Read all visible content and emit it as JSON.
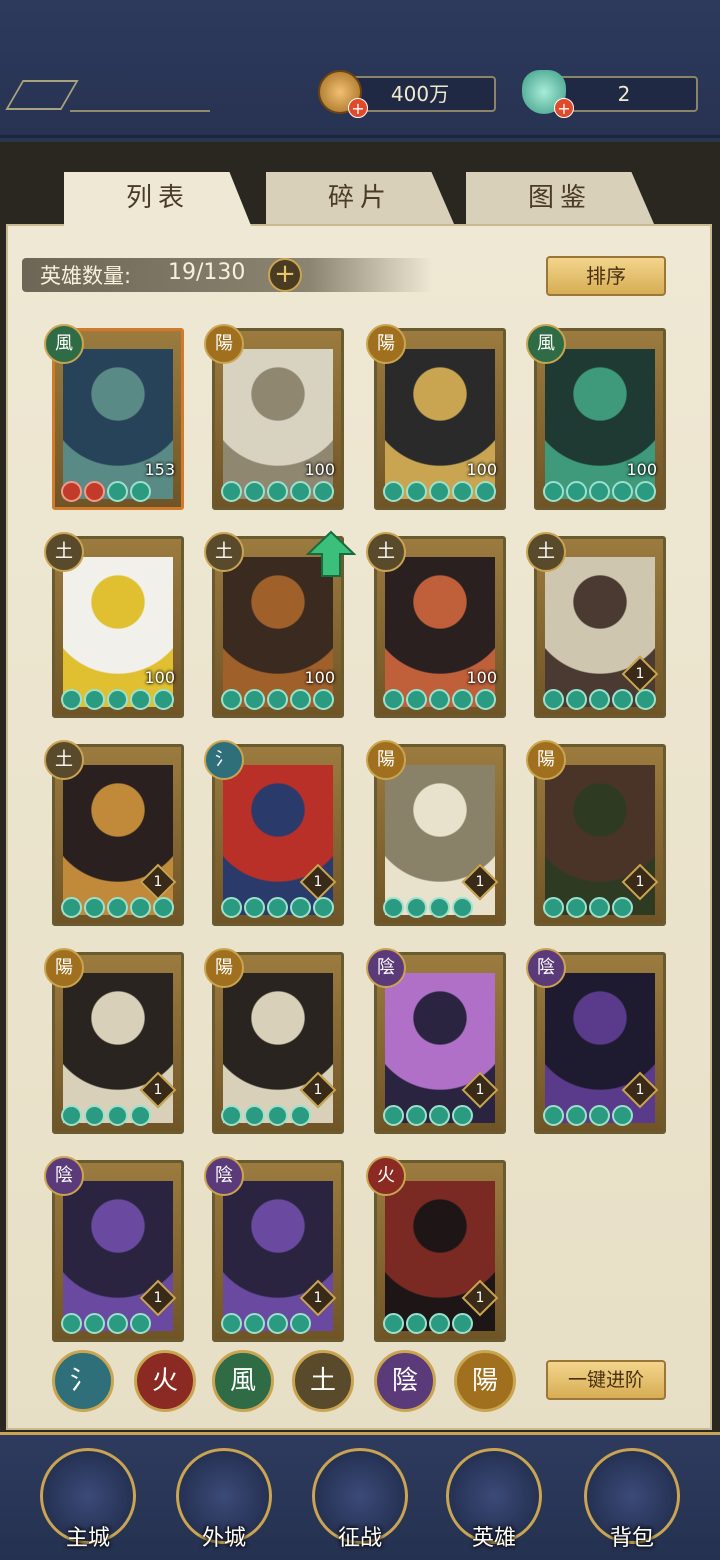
{
  "resources": {
    "coins": "400万",
    "jade": "2"
  },
  "tabs": [
    "列表",
    "碎片",
    "图鉴"
  ],
  "hero_count": {
    "label": "英雄数量:",
    "value": "19/130"
  },
  "sort_button": "排序",
  "advance_button": "一键进阶",
  "elements": {
    "water": "氵",
    "fire": "火",
    "wind": "風",
    "earth": "土",
    "yin": "陰",
    "yang": "陽"
  },
  "element_colors": {
    "water": "#2f6f7a",
    "fire": "#8a2a22",
    "wind": "#2f6b45",
    "earth": "#5a4a2c",
    "yin": "#5b3a7a",
    "yang": "#a0701e"
  },
  "heroes": [
    {
      "element": "wind",
      "level": "153",
      "stars": 2,
      "red_stars": 2,
      "frame": "orange",
      "badge": "text",
      "palette": [
        "#27435a",
        "#5a8a86"
      ]
    },
    {
      "element": "yang",
      "level": "100",
      "stars": 5,
      "red_stars": 0,
      "frame": "gold",
      "badge": "text",
      "palette": [
        "#d8d2c0",
        "#8f8770"
      ]
    },
    {
      "element": "yang",
      "level": "100",
      "stars": 5,
      "red_stars": 0,
      "frame": "gold",
      "badge": "text",
      "palette": [
        "#2a2a2a",
        "#c9a552"
      ]
    },
    {
      "element": "wind",
      "level": "100",
      "stars": 5,
      "red_stars": 0,
      "frame": "gold",
      "badge": "text",
      "palette": [
        "#1f3a32",
        "#3e9a7a"
      ]
    },
    {
      "element": "earth",
      "level": "100",
      "stars": 5,
      "red_stars": 0,
      "frame": "gold",
      "badge": "text",
      "palette": [
        "#f2f0ea",
        "#e0c030"
      ]
    },
    {
      "element": "earth",
      "level": "100",
      "stars": 5,
      "red_stars": 0,
      "frame": "gold",
      "badge": "text",
      "palette": [
        "#3a2a20",
        "#a0602a"
      ]
    },
    {
      "element": "earth",
      "level": "100",
      "stars": 5,
      "red_stars": 0,
      "frame": "gold",
      "badge": "text",
      "palette": [
        "#2a2020",
        "#c0603a"
      ]
    },
    {
      "element": "earth",
      "level": "1",
      "stars": 5,
      "red_stars": 0,
      "frame": "gold",
      "badge": "diamond",
      "palette": [
        "#cfc6b0",
        "#4a3a32"
      ]
    },
    {
      "element": "earth",
      "level": "1",
      "stars": 5,
      "red_stars": 0,
      "frame": "gold",
      "badge": "diamond",
      "palette": [
        "#2a2020",
        "#c08a3a"
      ]
    },
    {
      "element": "water",
      "level": "1",
      "stars": 5,
      "red_stars": 0,
      "frame": "gold",
      "badge": "diamond",
      "palette": [
        "#b83028",
        "#2a3a6a"
      ]
    },
    {
      "element": "yang",
      "level": "1",
      "stars": 4,
      "red_stars": 0,
      "frame": "gold",
      "badge": "diamond",
      "palette": [
        "#8a8268",
        "#e8e2cc"
      ]
    },
    {
      "element": "yang",
      "level": "1",
      "stars": 4,
      "red_stars": 0,
      "frame": "gold",
      "badge": "diamond",
      "palette": [
        "#4a3428",
        "#2e3a22"
      ]
    },
    {
      "element": "yang",
      "level": "1",
      "stars": 4,
      "red_stars": 0,
      "frame": "gold",
      "badge": "diamond",
      "palette": [
        "#2a2420",
        "#d8d0b8"
      ]
    },
    {
      "element": "yang",
      "level": "1",
      "stars": 4,
      "red_stars": 0,
      "frame": "gold",
      "badge": "diamond",
      "palette": [
        "#2a2420",
        "#d8d0b8"
      ]
    },
    {
      "element": "yin",
      "level": "1",
      "stars": 4,
      "red_stars": 0,
      "frame": "gold",
      "badge": "diamond",
      "palette": [
        "#b070c8",
        "#2a2440"
      ]
    },
    {
      "element": "yin",
      "level": "1",
      "stars": 4,
      "red_stars": 0,
      "frame": "gold",
      "badge": "diamond",
      "palette": [
        "#1e1a30",
        "#5a3a8a"
      ]
    },
    {
      "element": "yin",
      "level": "1",
      "stars": 4,
      "red_stars": 0,
      "frame": "gold",
      "badge": "diamond",
      "palette": [
        "#2a2440",
        "#6a4aa0"
      ]
    },
    {
      "element": "yin",
      "level": "1",
      "stars": 4,
      "red_stars": 0,
      "frame": "gold",
      "badge": "diamond",
      "palette": [
        "#2a2440",
        "#6a4aa0"
      ]
    },
    {
      "element": "fire",
      "level": "1",
      "stars": 4,
      "red_stars": 0,
      "frame": "gold",
      "badge": "diamond",
      "palette": [
        "#7a2a22",
        "#1e1616"
      ]
    }
  ],
  "element_filters": [
    "water",
    "fire",
    "wind",
    "earth",
    "yin",
    "yang"
  ],
  "bottom_nav": [
    {
      "label": "主城",
      "icon": "palace-icon"
    },
    {
      "label": "外城",
      "icon": "city-gate-icon"
    },
    {
      "label": "征战",
      "icon": "war-drum-icon"
    },
    {
      "label": "英雄",
      "icon": "hero-portrait-icon"
    },
    {
      "label": "背包",
      "icon": "bag-icon"
    }
  ]
}
